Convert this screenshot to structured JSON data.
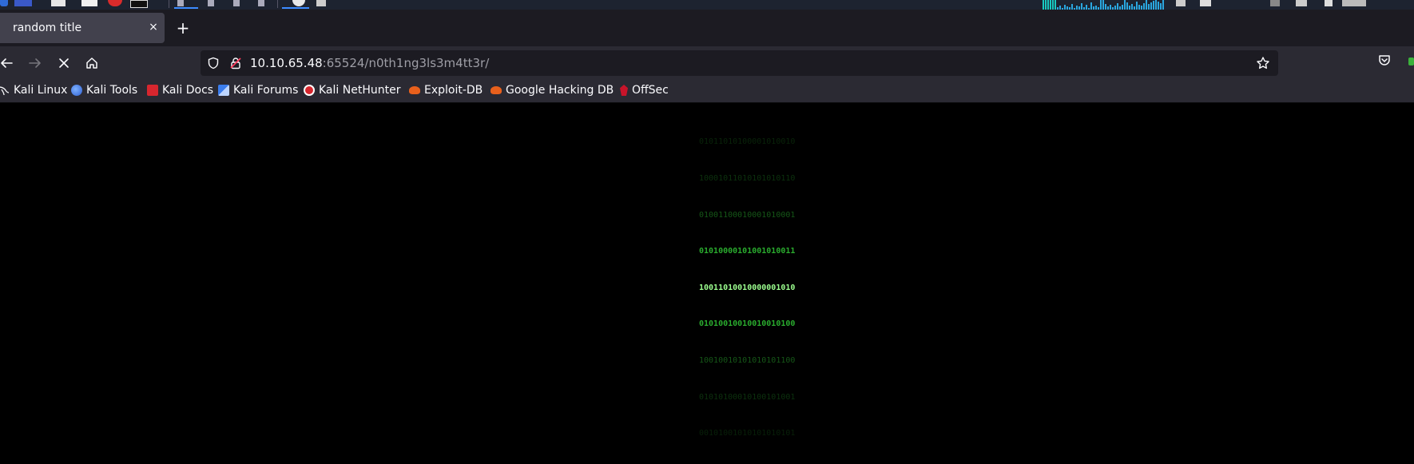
{
  "browser": {
    "tab_title": "random title",
    "tab_close_glyph": "×",
    "new_tab_glyph": "+",
    "url_host": "10.10.65.48",
    "url_rest": ":65524/n0th1ng3ls3m4tt3r/"
  },
  "bookmarks": [
    {
      "label": "Kali Linux",
      "icon": "kali-dragon-icon"
    },
    {
      "label": "Kali Tools",
      "icon": "kali-tools-icon"
    },
    {
      "label": "Kali Docs",
      "icon": "kali-docs-icon"
    },
    {
      "label": "Kali Forums",
      "icon": "kali-forums-icon"
    },
    {
      "label": "Kali NetHunter",
      "icon": "kali-nethunter-icon"
    },
    {
      "label": "Exploit-DB",
      "icon": "exploit-db-icon"
    },
    {
      "label": "Google Hacking DB",
      "icon": "ghdb-icon"
    },
    {
      "label": "OffSec",
      "icon": "offsec-icon"
    }
  ],
  "matrix_lines": [
    "01011010100001010010",
    "10001011010101010110",
    "01001100010001010001",
    "01010000101001010011",
    "10011010010000001010",
    "01010010010010010100",
    "10010010101010101100",
    "01010100010100101001",
    "00101001010101010101"
  ],
  "colors": {
    "tab_active": "#42414d",
    "toolbar": "#2b2a33",
    "urlbar": "#1c1b22",
    "matrix_green": "#2fbf34",
    "content_bg": "#000000"
  }
}
